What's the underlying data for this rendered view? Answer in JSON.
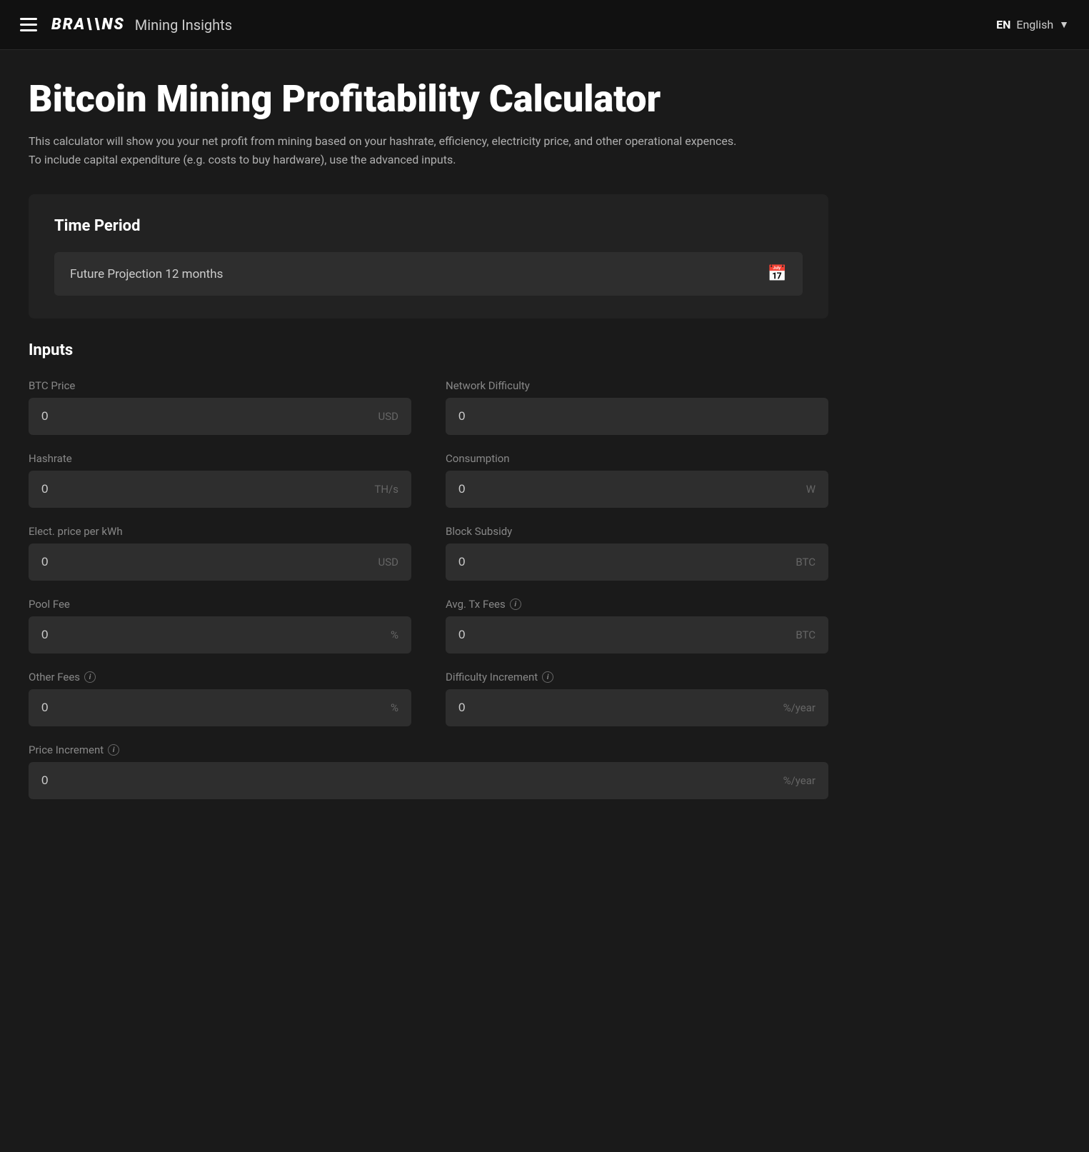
{
  "navbar": {
    "menu_icon": "hamburger",
    "brand_logo": "BRA\\\\NS",
    "brand_name": "Mining Insights",
    "lang_code": "EN",
    "lang_label": "English",
    "chevron": "▼"
  },
  "page": {
    "title": "Bitcoin Mining Profitability Calculator",
    "description": "This calculator will show you your net profit from mining based on your hashrate, efficiency, electricity price, and other operational expences. To include capital expenditure (e.g. costs to buy hardware), use the advanced inputs."
  },
  "time_period": {
    "section_title": "Time Period",
    "selected_label": "Future Projection 12 months",
    "calendar_icon": "📅"
  },
  "inputs": {
    "section_title": "Inputs",
    "fields": [
      {
        "id": "btc-price",
        "label": "BTC Price",
        "value": "0",
        "unit": "USD",
        "has_info": false,
        "full_width": false
      },
      {
        "id": "network-difficulty",
        "label": "Network Difficulty",
        "value": "0",
        "unit": "",
        "has_info": false,
        "full_width": false
      },
      {
        "id": "hashrate",
        "label": "Hashrate",
        "value": "0",
        "unit": "TH/s",
        "has_info": false,
        "full_width": false
      },
      {
        "id": "consumption",
        "label": "Consumption",
        "value": "0",
        "unit": "W",
        "has_info": false,
        "full_width": false
      },
      {
        "id": "elect-price",
        "label": "Elect. price per kWh",
        "value": "0",
        "unit": "USD",
        "has_info": false,
        "full_width": false
      },
      {
        "id": "block-subsidy",
        "label": "Block Subsidy",
        "value": "0",
        "unit": "BTC",
        "has_info": false,
        "full_width": false
      },
      {
        "id": "pool-fee",
        "label": "Pool Fee",
        "value": "0",
        "unit": "%",
        "has_info": false,
        "full_width": false
      },
      {
        "id": "avg-tx-fees",
        "label": "Avg. Tx Fees",
        "value": "0",
        "unit": "BTC",
        "has_info": true,
        "full_width": false
      },
      {
        "id": "other-fees",
        "label": "Other Fees",
        "value": "0",
        "unit": "%",
        "has_info": true,
        "full_width": false
      },
      {
        "id": "difficulty-increment",
        "label": "Difficulty Increment",
        "value": "0",
        "unit": "%/year",
        "has_info": true,
        "full_width": false
      },
      {
        "id": "price-increment",
        "label": "Price Increment",
        "value": "0",
        "unit": "%/year",
        "has_info": true,
        "full_width": true
      }
    ]
  },
  "colors": {
    "background": "#1a1a1a",
    "navbar_bg": "#111111",
    "card_bg": "#222222",
    "input_bg": "#2e2e2e",
    "text_primary": "#ffffff",
    "text_secondary": "#cccccc",
    "text_muted": "#888888",
    "text_unit": "#666666"
  }
}
